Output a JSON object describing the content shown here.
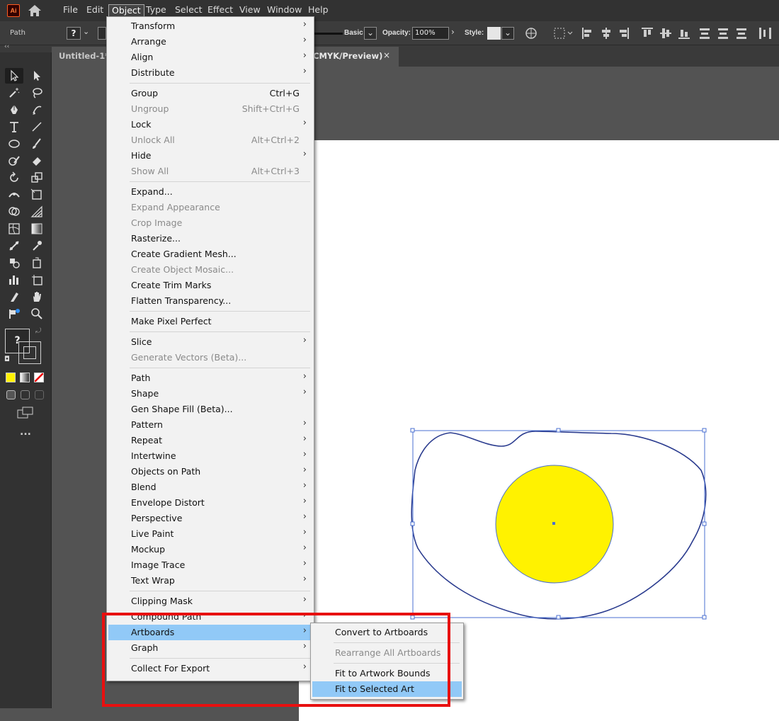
{
  "menubar": {
    "logo": "Ai",
    "menus": [
      "File",
      "Edit",
      "Object",
      "Type",
      "Select",
      "Effect",
      "View",
      "Window",
      "Help"
    ],
    "active_menu": "Object"
  },
  "controlbar": {
    "selection_type": "Path",
    "brush_label": "Basic",
    "opacity_label": "Opacity:",
    "opacity_value": "100%",
    "style_label": "Style:",
    "unknown_fill": "?"
  },
  "document_tab": {
    "title_visible_left": "Untitled-1* @",
    "title_visible_right": "CMYK/Preview)",
    "close_glyph": "×"
  },
  "toolbar": {
    "unknown_swatch": "?",
    "more_tools": "..."
  },
  "object_menu": {
    "items": [
      {
        "label": "Transform",
        "shortcut": "",
        "submenu": true,
        "enabled": true
      },
      {
        "label": "Arrange",
        "shortcut": "",
        "submenu": true,
        "enabled": true
      },
      {
        "label": "Align",
        "shortcut": "",
        "submenu": true,
        "enabled": true
      },
      {
        "label": "Distribute",
        "shortcut": "",
        "submenu": true,
        "enabled": true
      },
      {
        "label": "Group",
        "shortcut": "Ctrl+G",
        "submenu": false,
        "enabled": true
      },
      {
        "label": "Ungroup",
        "shortcut": "Shift+Ctrl+G",
        "submenu": false,
        "enabled": false
      },
      {
        "label": "Lock",
        "shortcut": "",
        "submenu": true,
        "enabled": true
      },
      {
        "label": "Unlock All",
        "shortcut": "Alt+Ctrl+2",
        "submenu": false,
        "enabled": false
      },
      {
        "label": "Hide",
        "shortcut": "",
        "submenu": true,
        "enabled": true
      },
      {
        "label": "Show All",
        "shortcut": "Alt+Ctrl+3",
        "submenu": false,
        "enabled": false
      },
      {
        "label": "Expand...",
        "shortcut": "",
        "submenu": false,
        "enabled": true
      },
      {
        "label": "Expand Appearance",
        "shortcut": "",
        "submenu": false,
        "enabled": false
      },
      {
        "label": "Crop Image",
        "shortcut": "",
        "submenu": false,
        "enabled": false
      },
      {
        "label": "Rasterize...",
        "shortcut": "",
        "submenu": false,
        "enabled": true
      },
      {
        "label": "Create Gradient Mesh...",
        "shortcut": "",
        "submenu": false,
        "enabled": true
      },
      {
        "label": "Create Object Mosaic...",
        "shortcut": "",
        "submenu": false,
        "enabled": false
      },
      {
        "label": "Create Trim Marks",
        "shortcut": "",
        "submenu": false,
        "enabled": true
      },
      {
        "label": "Flatten Transparency...",
        "shortcut": "",
        "submenu": false,
        "enabled": true
      },
      {
        "label": "Make Pixel Perfect",
        "shortcut": "",
        "submenu": false,
        "enabled": true
      },
      {
        "label": "Slice",
        "shortcut": "",
        "submenu": true,
        "enabled": true
      },
      {
        "label": "Generate Vectors (Beta)...",
        "shortcut": "",
        "submenu": false,
        "enabled": false
      },
      {
        "label": "Path",
        "shortcut": "",
        "submenu": true,
        "enabled": true
      },
      {
        "label": "Shape",
        "shortcut": "",
        "submenu": true,
        "enabled": true
      },
      {
        "label": "Gen Shape Fill (Beta)...",
        "shortcut": "",
        "submenu": false,
        "enabled": true
      },
      {
        "label": "Pattern",
        "shortcut": "",
        "submenu": true,
        "enabled": true
      },
      {
        "label": "Repeat",
        "shortcut": "",
        "submenu": true,
        "enabled": true
      },
      {
        "label": "Intertwine",
        "shortcut": "",
        "submenu": true,
        "enabled": true
      },
      {
        "label": "Objects on Path",
        "shortcut": "",
        "submenu": true,
        "enabled": true
      },
      {
        "label": "Blend",
        "shortcut": "",
        "submenu": true,
        "enabled": true
      },
      {
        "label": "Envelope Distort",
        "shortcut": "",
        "submenu": true,
        "enabled": true
      },
      {
        "label": "Perspective",
        "shortcut": "",
        "submenu": true,
        "enabled": true
      },
      {
        "label": "Live Paint",
        "shortcut": "",
        "submenu": true,
        "enabled": true
      },
      {
        "label": "Mockup",
        "shortcut": "",
        "submenu": true,
        "enabled": true
      },
      {
        "label": "Image Trace",
        "shortcut": "",
        "submenu": true,
        "enabled": true
      },
      {
        "label": "Text Wrap",
        "shortcut": "",
        "submenu": true,
        "enabled": true
      },
      {
        "label": "Clipping Mask",
        "shortcut": "",
        "submenu": true,
        "enabled": true
      },
      {
        "label": "Compound Path",
        "shortcut": "",
        "submenu": true,
        "enabled": true
      },
      {
        "label": "Artboards",
        "shortcut": "",
        "submenu": true,
        "enabled": true,
        "highlighted": true
      },
      {
        "label": "Graph",
        "shortcut": "",
        "submenu": true,
        "enabled": true
      },
      {
        "label": "Collect For Export",
        "shortcut": "",
        "submenu": true,
        "enabled": true
      }
    ]
  },
  "artboards_submenu": {
    "items": [
      {
        "label": "Convert to Artboards",
        "enabled": true
      },
      {
        "label": "Rearrange All Artboards",
        "enabled": false
      },
      {
        "label": "Fit to Artwork Bounds",
        "enabled": true
      },
      {
        "label": "Fit to Selected Art",
        "enabled": true,
        "highlighted": true
      }
    ]
  },
  "colors": {
    "menu_highlight": "#91c9f7",
    "annotation": "#e81010",
    "selection": "#4a6fd1",
    "yolk": "#fff200"
  }
}
